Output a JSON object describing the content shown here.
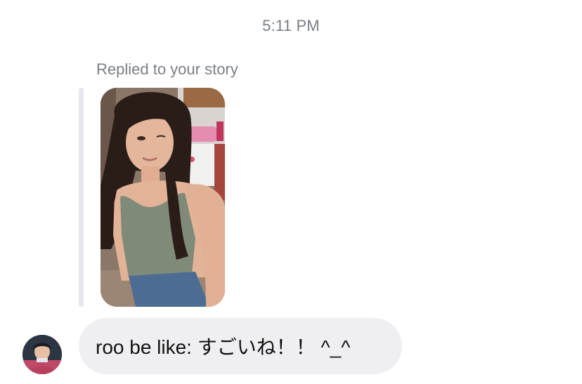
{
  "conversation": {
    "timestamp": "5:11 PM",
    "reply_context": {
      "label": "Replied to your story",
      "thumbnail_icon": "story-photo-thumbnail"
    },
    "message": {
      "text": "roo be like: すごいね！！ ^_^",
      "sender_avatar_icon": "user-avatar"
    }
  },
  "colors": {
    "meta_text": "#7a7e85",
    "bubble_bg": "#efeff1",
    "reply_bar": "#e6e7ea"
  }
}
